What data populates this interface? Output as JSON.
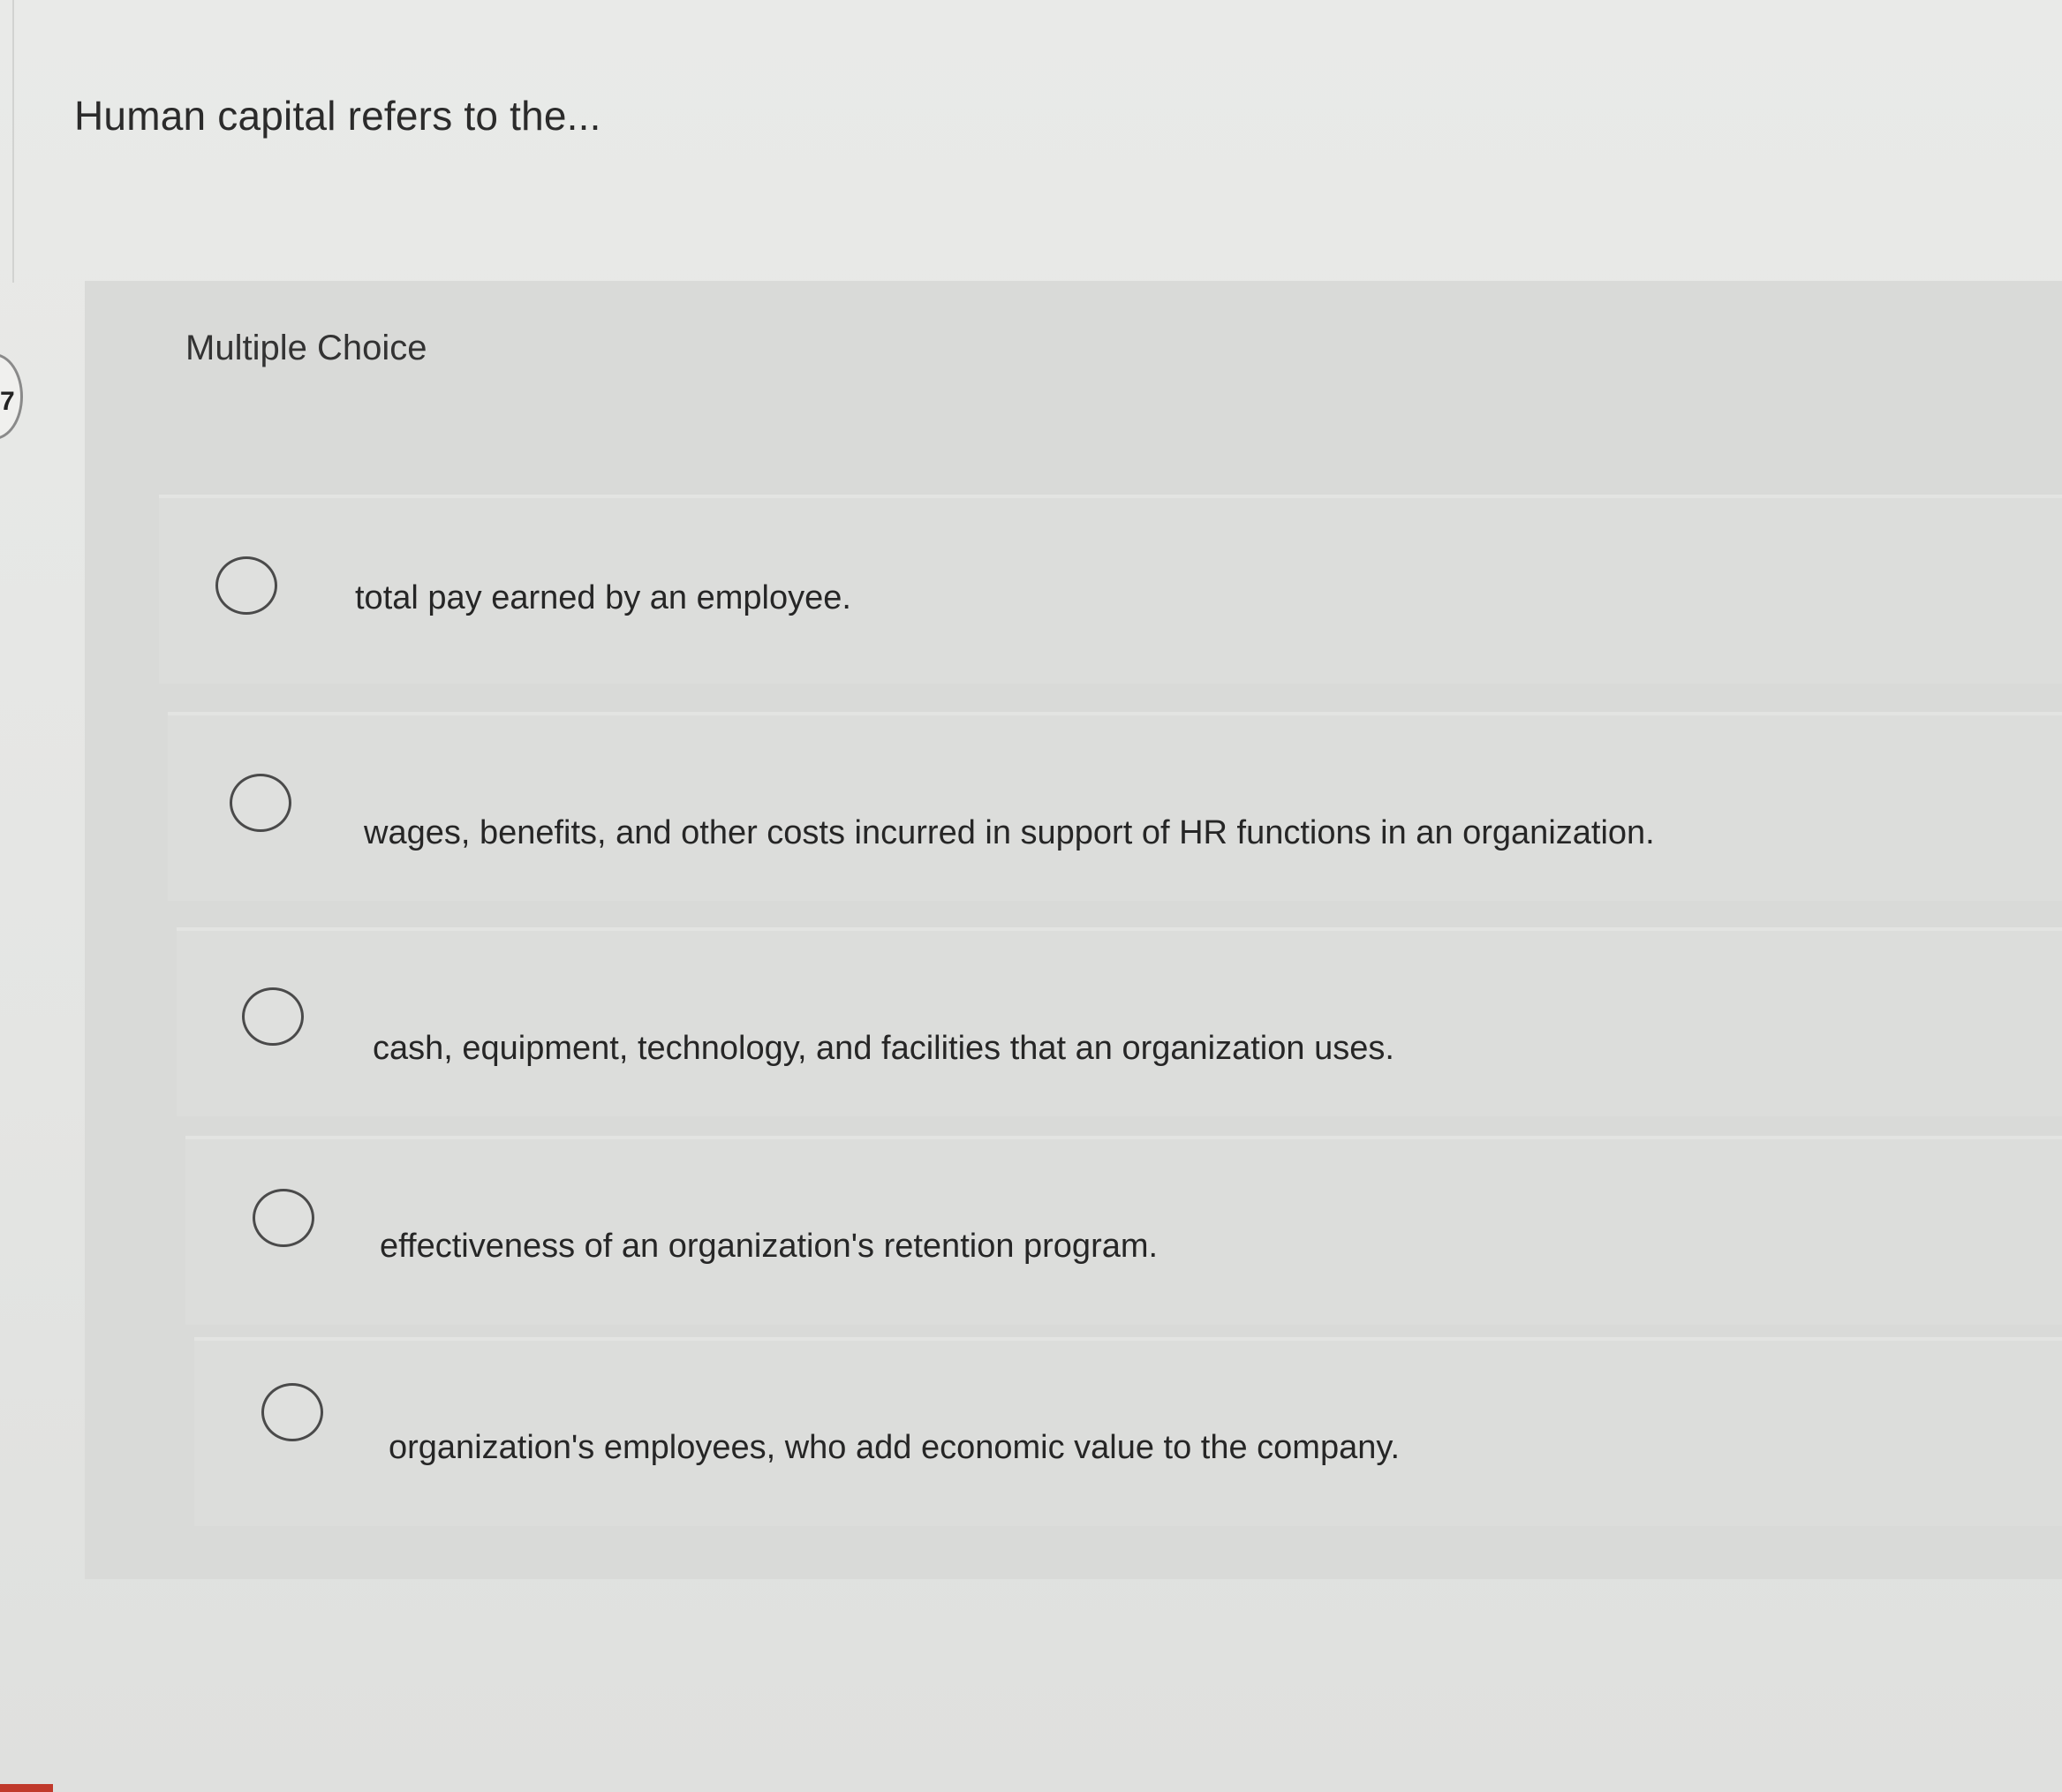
{
  "question": {
    "number": "7",
    "text": "Human capital refers to the..."
  },
  "choices": {
    "header": "Multiple Choice",
    "options": [
      {
        "label": "total pay earned by an employee."
      },
      {
        "label": "wages, benefits, and other costs incurred in support of HR functions in an organization."
      },
      {
        "label": "cash, equipment, technology, and facilities that an organization uses."
      },
      {
        "label": "effectiveness of an organization's retention program."
      },
      {
        "label": "organization's employees, who add economic value to the company."
      }
    ]
  }
}
